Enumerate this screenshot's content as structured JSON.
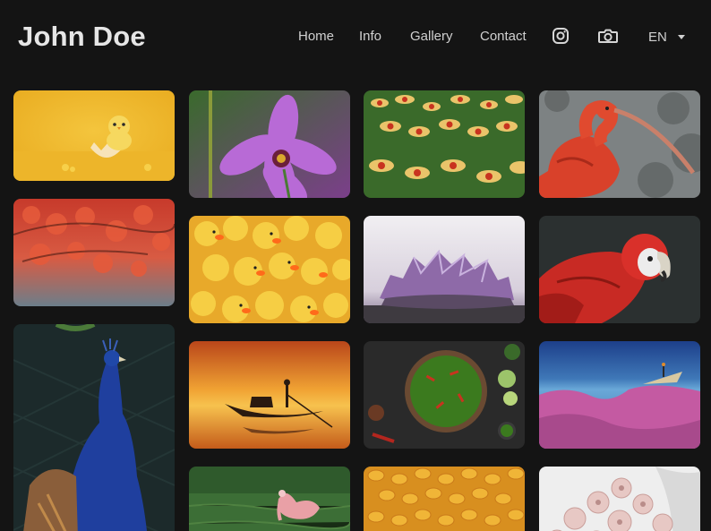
{
  "site": {
    "title": "John Doe"
  },
  "nav": {
    "items": [
      {
        "label": "Home"
      },
      {
        "label": "Info"
      },
      {
        "label": "Gallery"
      },
      {
        "label": "Contact"
      }
    ],
    "instagram_icon": "instagram-icon",
    "camera_icon": "camera-icon",
    "language": {
      "selected": "EN"
    }
  },
  "gallery": {
    "photos": [
      {
        "subject": "chick",
        "colors": [
          "#f2c12e",
          "#e7a91d"
        ]
      },
      {
        "subject": "pink-flower",
        "colors": [
          "#8a3fb7",
          "#3f6b2e"
        ]
      },
      {
        "subject": "yellow-flowers-field",
        "colors": [
          "#d4b040",
          "#3d6b2a"
        ]
      },
      {
        "subject": "scarlet-ibis",
        "colors": [
          "#d9462e",
          "#7a7f80"
        ]
      },
      {
        "subject": "red-leaves",
        "colors": [
          "#c53a2a",
          "#6b7b86"
        ]
      },
      {
        "subject": "rubber-ducks",
        "colors": [
          "#f0c53a",
          "#e9a82a"
        ]
      },
      {
        "subject": "amethyst",
        "colors": [
          "#9b7ab8",
          "#e9e6ea"
        ]
      },
      {
        "subject": "macaw",
        "colors": [
          "#cc2a26",
          "#2b2b2b"
        ]
      },
      {
        "subject": "peacock",
        "colors": [
          "#1e3f9a",
          "#1d2a2a"
        ]
      },
      {
        "subject": "boat-sunset",
        "colors": [
          "#e69227",
          "#6c2b12"
        ]
      },
      {
        "subject": "green-soup",
        "colors": [
          "#3a7a1a",
          "#2a2a2a"
        ]
      },
      {
        "subject": "pink-landscape",
        "colors": [
          "#c45aa2",
          "#3a6aa8"
        ]
      },
      {
        "subject": "flamingo",
        "colors": [
          "#3f6a34",
          "#d97e86"
        ]
      },
      {
        "subject": "pasta",
        "colors": [
          "#e8aa2d",
          "#d88d1f"
        ]
      },
      {
        "subject": "roses",
        "colors": [
          "#e8d7d4",
          "#f0f0f0"
        ]
      }
    ]
  }
}
